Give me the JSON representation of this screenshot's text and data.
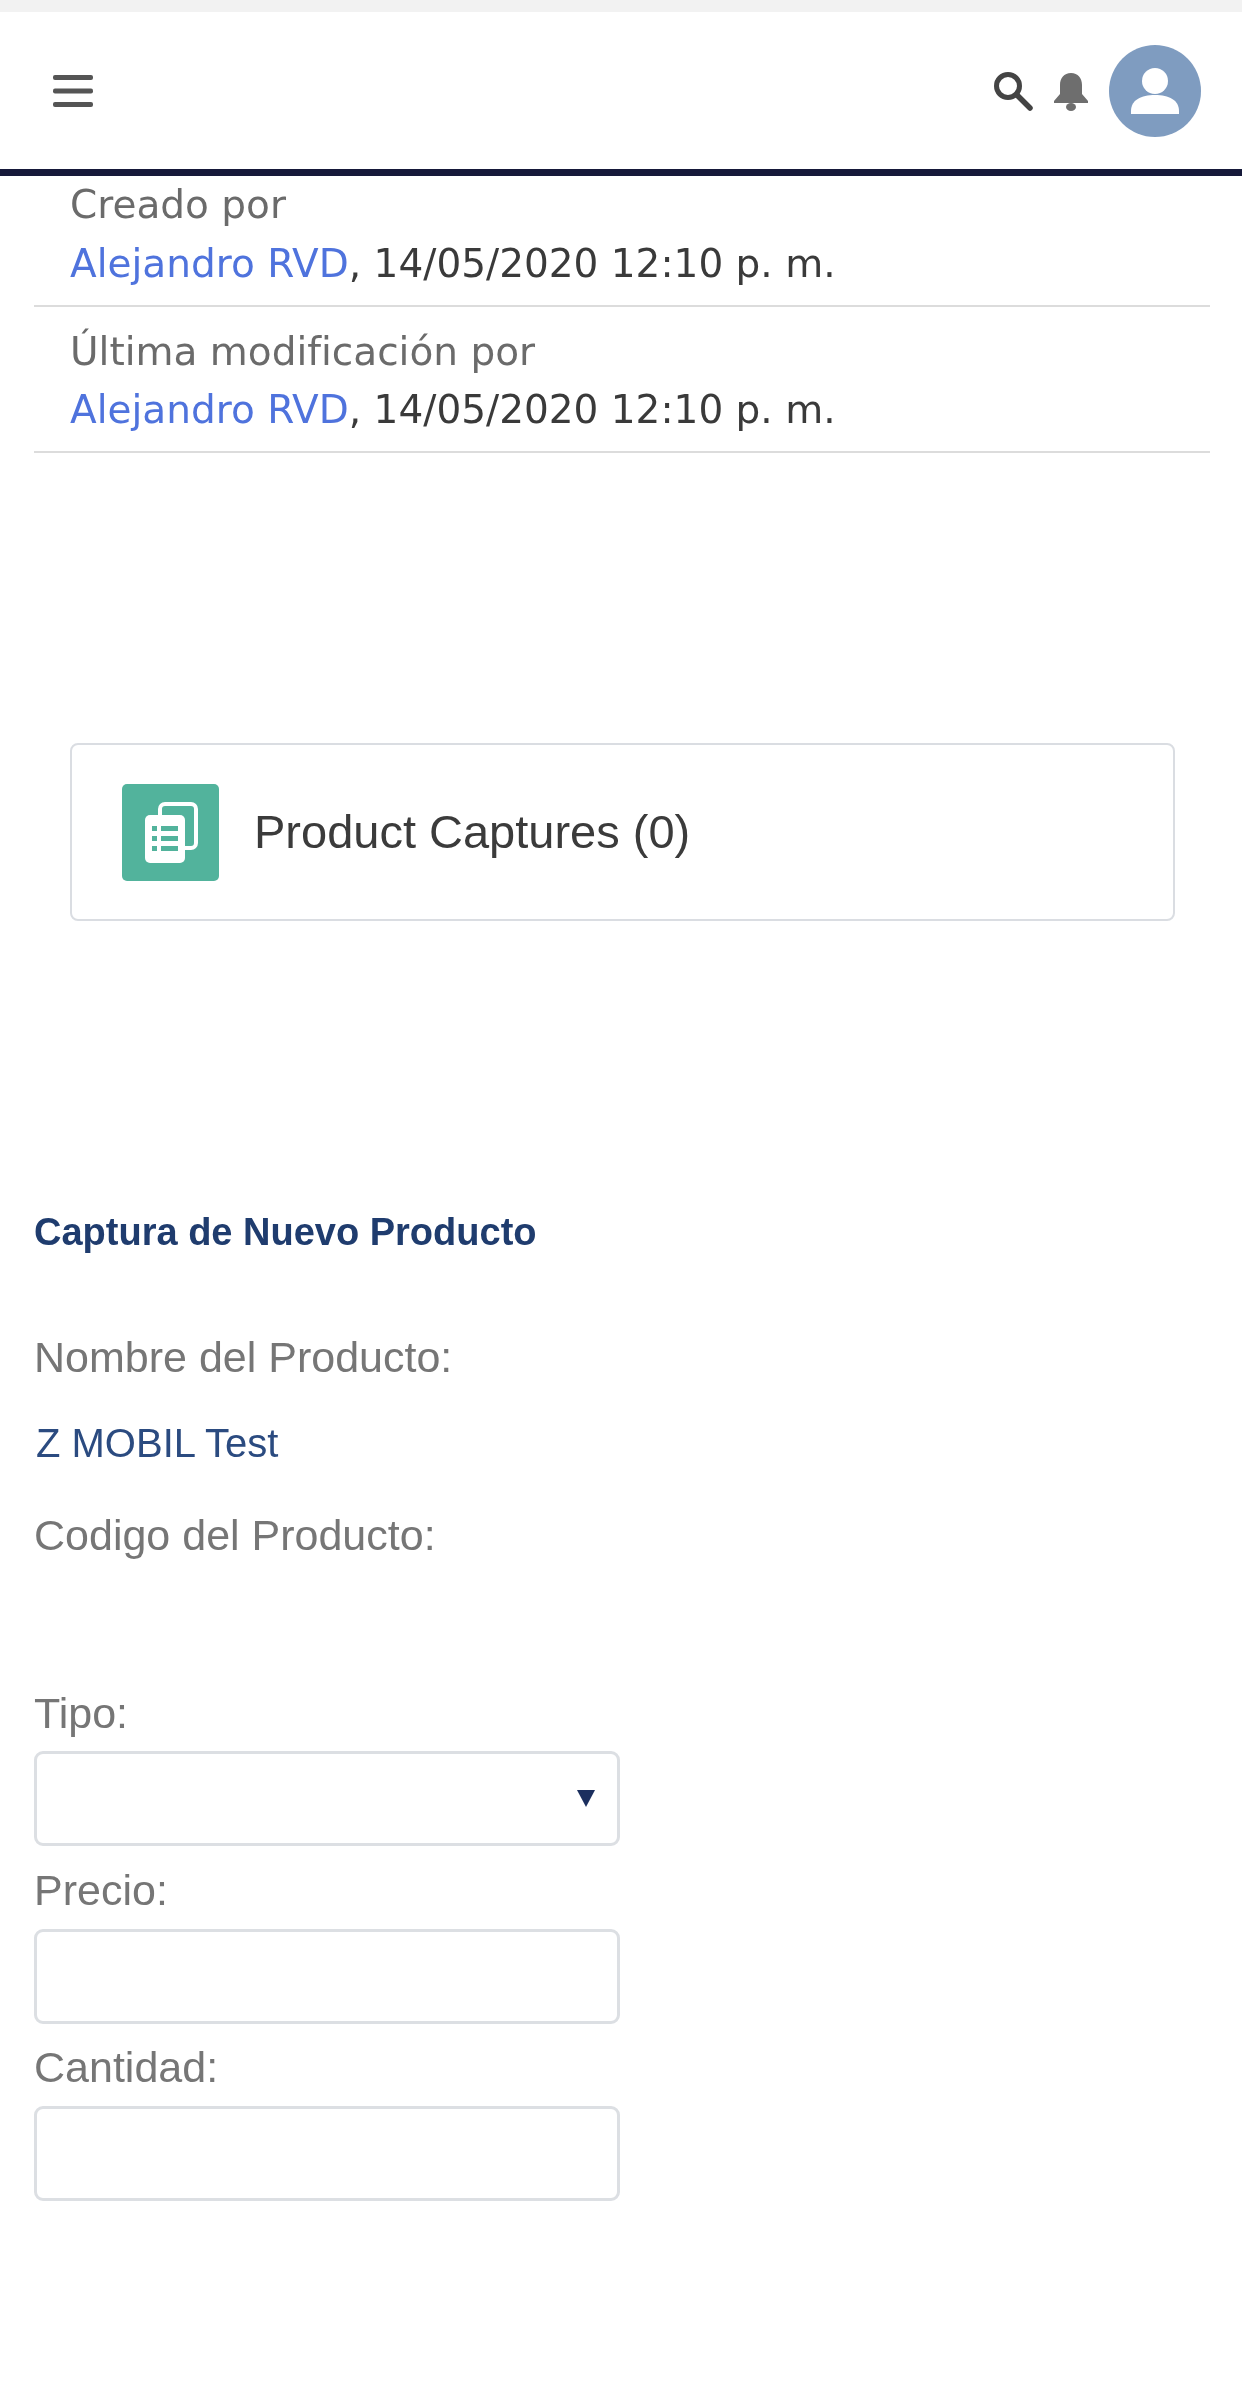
{
  "record_fields": [
    {
      "label": "Creado por",
      "user": "Alejandro RVD",
      "suffix": ", 14/05/2020 12:10 p. m."
    },
    {
      "label": "Última modificación por",
      "user": "Alejandro RVD",
      "suffix": ", 14/05/2020 12:10 p. m."
    }
  ],
  "related_list": {
    "title": "Product Captures (0)"
  },
  "form": {
    "title": "Captura de Nuevo Producto",
    "fields": [
      {
        "kind": "readonly",
        "label": "Nombre del Producto:",
        "value": "Z MOBIL Test"
      },
      {
        "kind": "readonly",
        "label": "Codigo del Producto:"
      },
      {
        "kind": "select",
        "label": "Tipo:"
      },
      {
        "kind": "input",
        "label": "Precio:"
      },
      {
        "kind": "input",
        "label": "Cantidad:"
      }
    ]
  }
}
